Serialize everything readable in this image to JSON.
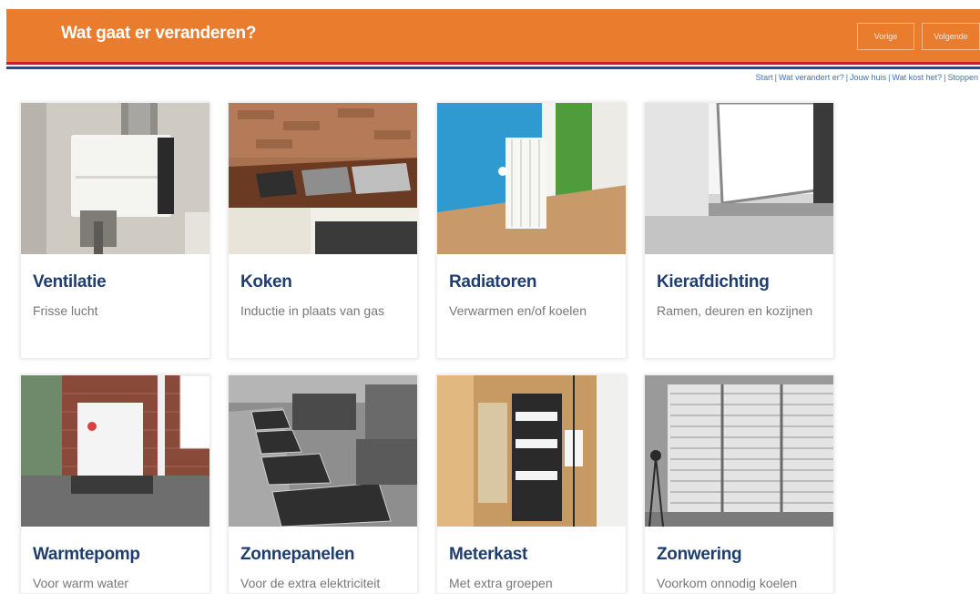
{
  "header": {
    "title": "Wat gaat er veranderen?",
    "prev_label": "Vorige",
    "next_label": "Volgende",
    "colors": {
      "bar": "#ea7d2d",
      "stripe_red": "#c8202b",
      "stripe_blue": "#1d4e8f"
    }
  },
  "breadcrumb": {
    "items": [
      "Start",
      "Wat verandert er?",
      "Jouw huis",
      "Wat kost het?",
      "Stoppen"
    ],
    "separator": "|"
  },
  "cards": [
    {
      "title": "Ventilatie",
      "subtitle": "Frisse lucht"
    },
    {
      "title": "Koken",
      "subtitle": "Inductie in plaats van gas"
    },
    {
      "title": "Radiatoren",
      "subtitle": "Verwarmen en/of koelen"
    },
    {
      "title": "Kierafdichting",
      "subtitle": "Ramen, deuren en kozijnen"
    },
    {
      "title": "Warmtepomp",
      "subtitle": "Voor warm water"
    },
    {
      "title": "Zonnepanelen",
      "subtitle": "Voor de extra elektriciteit"
    },
    {
      "title": "Meterkast",
      "subtitle": "Met extra groepen"
    },
    {
      "title": "Zonwering",
      "subtitle": "Voorkom onnodig koelen"
    }
  ]
}
